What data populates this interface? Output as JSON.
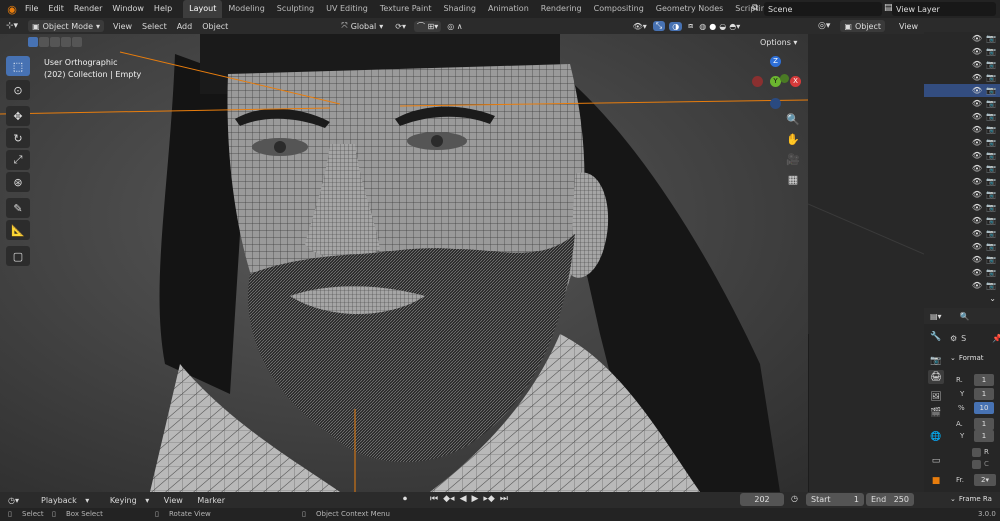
{
  "menu": [
    "File",
    "Edit",
    "Render",
    "Window",
    "Help"
  ],
  "workspaces": [
    "Layout",
    "Modeling",
    "Sculpting",
    "UV Editing",
    "Texture Paint",
    "Shading",
    "Animation",
    "Rendering",
    "Compositing",
    "Geometry Nodes",
    "Scripting"
  ],
  "active_workspace": "Layout",
  "scene": {
    "name": "Scene"
  },
  "view_layer": {
    "name": "View Layer"
  },
  "viewport_header": {
    "mode": "Object Mode",
    "menu": [
      "View",
      "Select",
      "Add",
      "Object"
    ],
    "transform_orientation": "Global",
    "options": "Options"
  },
  "overlay": {
    "view_name": "User Orthographic",
    "collection": "(202) Collection | Empty"
  },
  "gizmo": {
    "z": "Z",
    "x": "X",
    "y": "Y"
  },
  "right_editor": {
    "mode": "Object",
    "view": "View"
  },
  "properties": {
    "tab_label": "S",
    "section": "Format",
    "res_label": "R.",
    "res_x": "1",
    "res_y_label": "Y",
    "res_y": "1",
    "percent_label": "%",
    "percent": "10",
    "aspect_label": "A.",
    "aspect_x": "1",
    "aspect_y_label": "Y",
    "aspect_y": "1",
    "r_label": "R",
    "c_label": "C",
    "frame_rate_label": "Fr.",
    "frame_rate": "2",
    "frame_range": "Frame Ra"
  },
  "timeline": {
    "menu": [
      "Playback",
      "Keying",
      "View",
      "Marker"
    ],
    "current_frame": "202",
    "start_label": "Start",
    "start": "1",
    "end_label": "End",
    "end": "250"
  },
  "statusbar": {
    "select": "Select",
    "box_select": "Box Select",
    "rotate_view": "Rotate View",
    "context_menu": "Object Context Menu",
    "version": "3.0.0"
  },
  "colors": {
    "accent": "#4772b3",
    "orange": "#e87d0d"
  }
}
